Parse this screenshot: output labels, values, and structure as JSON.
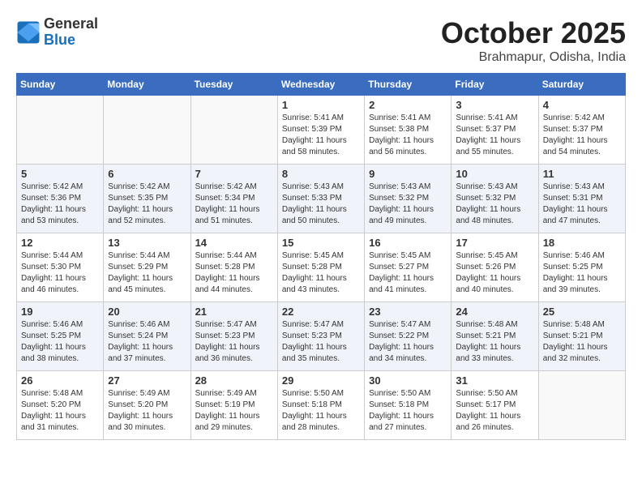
{
  "header": {
    "logo_general": "General",
    "logo_blue": "Blue",
    "month": "October 2025",
    "location": "Brahmapur, Odisha, India"
  },
  "days_of_week": [
    "Sunday",
    "Monday",
    "Tuesday",
    "Wednesday",
    "Thursday",
    "Friday",
    "Saturday"
  ],
  "weeks": [
    [
      {
        "day": "",
        "info": ""
      },
      {
        "day": "",
        "info": ""
      },
      {
        "day": "",
        "info": ""
      },
      {
        "day": "1",
        "info": "Sunrise: 5:41 AM\nSunset: 5:39 PM\nDaylight: 11 hours and 58 minutes."
      },
      {
        "day": "2",
        "info": "Sunrise: 5:41 AM\nSunset: 5:38 PM\nDaylight: 11 hours and 56 minutes."
      },
      {
        "day": "3",
        "info": "Sunrise: 5:41 AM\nSunset: 5:37 PM\nDaylight: 11 hours and 55 minutes."
      },
      {
        "day": "4",
        "info": "Sunrise: 5:42 AM\nSunset: 5:37 PM\nDaylight: 11 hours and 54 minutes."
      }
    ],
    [
      {
        "day": "5",
        "info": "Sunrise: 5:42 AM\nSunset: 5:36 PM\nDaylight: 11 hours and 53 minutes."
      },
      {
        "day": "6",
        "info": "Sunrise: 5:42 AM\nSunset: 5:35 PM\nDaylight: 11 hours and 52 minutes."
      },
      {
        "day": "7",
        "info": "Sunrise: 5:42 AM\nSunset: 5:34 PM\nDaylight: 11 hours and 51 minutes."
      },
      {
        "day": "8",
        "info": "Sunrise: 5:43 AM\nSunset: 5:33 PM\nDaylight: 11 hours and 50 minutes."
      },
      {
        "day": "9",
        "info": "Sunrise: 5:43 AM\nSunset: 5:32 PM\nDaylight: 11 hours and 49 minutes."
      },
      {
        "day": "10",
        "info": "Sunrise: 5:43 AM\nSunset: 5:32 PM\nDaylight: 11 hours and 48 minutes."
      },
      {
        "day": "11",
        "info": "Sunrise: 5:43 AM\nSunset: 5:31 PM\nDaylight: 11 hours and 47 minutes."
      }
    ],
    [
      {
        "day": "12",
        "info": "Sunrise: 5:44 AM\nSunset: 5:30 PM\nDaylight: 11 hours and 46 minutes."
      },
      {
        "day": "13",
        "info": "Sunrise: 5:44 AM\nSunset: 5:29 PM\nDaylight: 11 hours and 45 minutes."
      },
      {
        "day": "14",
        "info": "Sunrise: 5:44 AM\nSunset: 5:28 PM\nDaylight: 11 hours and 44 minutes."
      },
      {
        "day": "15",
        "info": "Sunrise: 5:45 AM\nSunset: 5:28 PM\nDaylight: 11 hours and 43 minutes."
      },
      {
        "day": "16",
        "info": "Sunrise: 5:45 AM\nSunset: 5:27 PM\nDaylight: 11 hours and 41 minutes."
      },
      {
        "day": "17",
        "info": "Sunrise: 5:45 AM\nSunset: 5:26 PM\nDaylight: 11 hours and 40 minutes."
      },
      {
        "day": "18",
        "info": "Sunrise: 5:46 AM\nSunset: 5:25 PM\nDaylight: 11 hours and 39 minutes."
      }
    ],
    [
      {
        "day": "19",
        "info": "Sunrise: 5:46 AM\nSunset: 5:25 PM\nDaylight: 11 hours and 38 minutes."
      },
      {
        "day": "20",
        "info": "Sunrise: 5:46 AM\nSunset: 5:24 PM\nDaylight: 11 hours and 37 minutes."
      },
      {
        "day": "21",
        "info": "Sunrise: 5:47 AM\nSunset: 5:23 PM\nDaylight: 11 hours and 36 minutes."
      },
      {
        "day": "22",
        "info": "Sunrise: 5:47 AM\nSunset: 5:23 PM\nDaylight: 11 hours and 35 minutes."
      },
      {
        "day": "23",
        "info": "Sunrise: 5:47 AM\nSunset: 5:22 PM\nDaylight: 11 hours and 34 minutes."
      },
      {
        "day": "24",
        "info": "Sunrise: 5:48 AM\nSunset: 5:21 PM\nDaylight: 11 hours and 33 minutes."
      },
      {
        "day": "25",
        "info": "Sunrise: 5:48 AM\nSunset: 5:21 PM\nDaylight: 11 hours and 32 minutes."
      }
    ],
    [
      {
        "day": "26",
        "info": "Sunrise: 5:48 AM\nSunset: 5:20 PM\nDaylight: 11 hours and 31 minutes."
      },
      {
        "day": "27",
        "info": "Sunrise: 5:49 AM\nSunset: 5:20 PM\nDaylight: 11 hours and 30 minutes."
      },
      {
        "day": "28",
        "info": "Sunrise: 5:49 AM\nSunset: 5:19 PM\nDaylight: 11 hours and 29 minutes."
      },
      {
        "day": "29",
        "info": "Sunrise: 5:50 AM\nSunset: 5:18 PM\nDaylight: 11 hours and 28 minutes."
      },
      {
        "day": "30",
        "info": "Sunrise: 5:50 AM\nSunset: 5:18 PM\nDaylight: 11 hours and 27 minutes."
      },
      {
        "day": "31",
        "info": "Sunrise: 5:50 AM\nSunset: 5:17 PM\nDaylight: 11 hours and 26 minutes."
      },
      {
        "day": "",
        "info": ""
      }
    ]
  ]
}
